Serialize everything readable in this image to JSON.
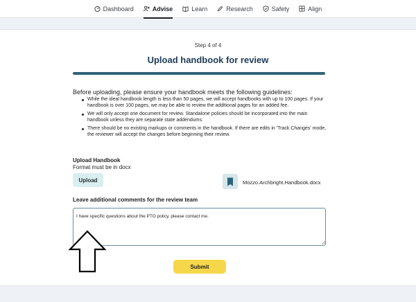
{
  "nav": {
    "items": [
      {
        "label": "Dashboard",
        "icon": "dashboard-icon",
        "active": false
      },
      {
        "label": "Advise",
        "icon": "advise-icon",
        "active": true
      },
      {
        "label": "Learn",
        "icon": "book-icon",
        "active": false
      },
      {
        "label": "Research",
        "icon": "pen-icon",
        "active": false
      },
      {
        "label": "Safety",
        "icon": "shield-check-icon",
        "active": false
      },
      {
        "label": "Align",
        "icon": "grid-icon",
        "active": false
      }
    ]
  },
  "step": {
    "text": "Step 4 of 4",
    "progress_fraction": 1.0
  },
  "page": {
    "title": "Upload handbook for review"
  },
  "guidelines": {
    "intro": "Before uploading, please ensure your handbook meets the following guidelines:",
    "items": [
      "While the ideal handbook length is less than 50 pages, we will accept handbooks with up to 100 pages. If your handbook is over 100 pages, we may be able to review the additional pages for an added fee.",
      "We will only accept one document for review. Standalone policies should be incorporated into the main handbook unless they are separate state addendums.",
      "There should be no existing markups or comments in the handbook. If there are edits in 'Track Changes' mode, the reviewer will accept the changes before beginning their review."
    ]
  },
  "upload": {
    "heading": "Upload Handbook",
    "format_note": "Format must be in docx",
    "button_label": "Upload",
    "file_name": "Mozzo.Archbright.Handbook.docx",
    "file_icon": "document-icon"
  },
  "comments": {
    "label": "Leave additional comments for the review team",
    "value": "I have specific questions about the PTO policy, please contact me."
  },
  "submit": {
    "label": "Submit"
  },
  "colors": {
    "title": "#1c3b57",
    "progress": "#2f6378",
    "upload_button": "#d9eeee",
    "submit_button": "#f7d74a"
  }
}
